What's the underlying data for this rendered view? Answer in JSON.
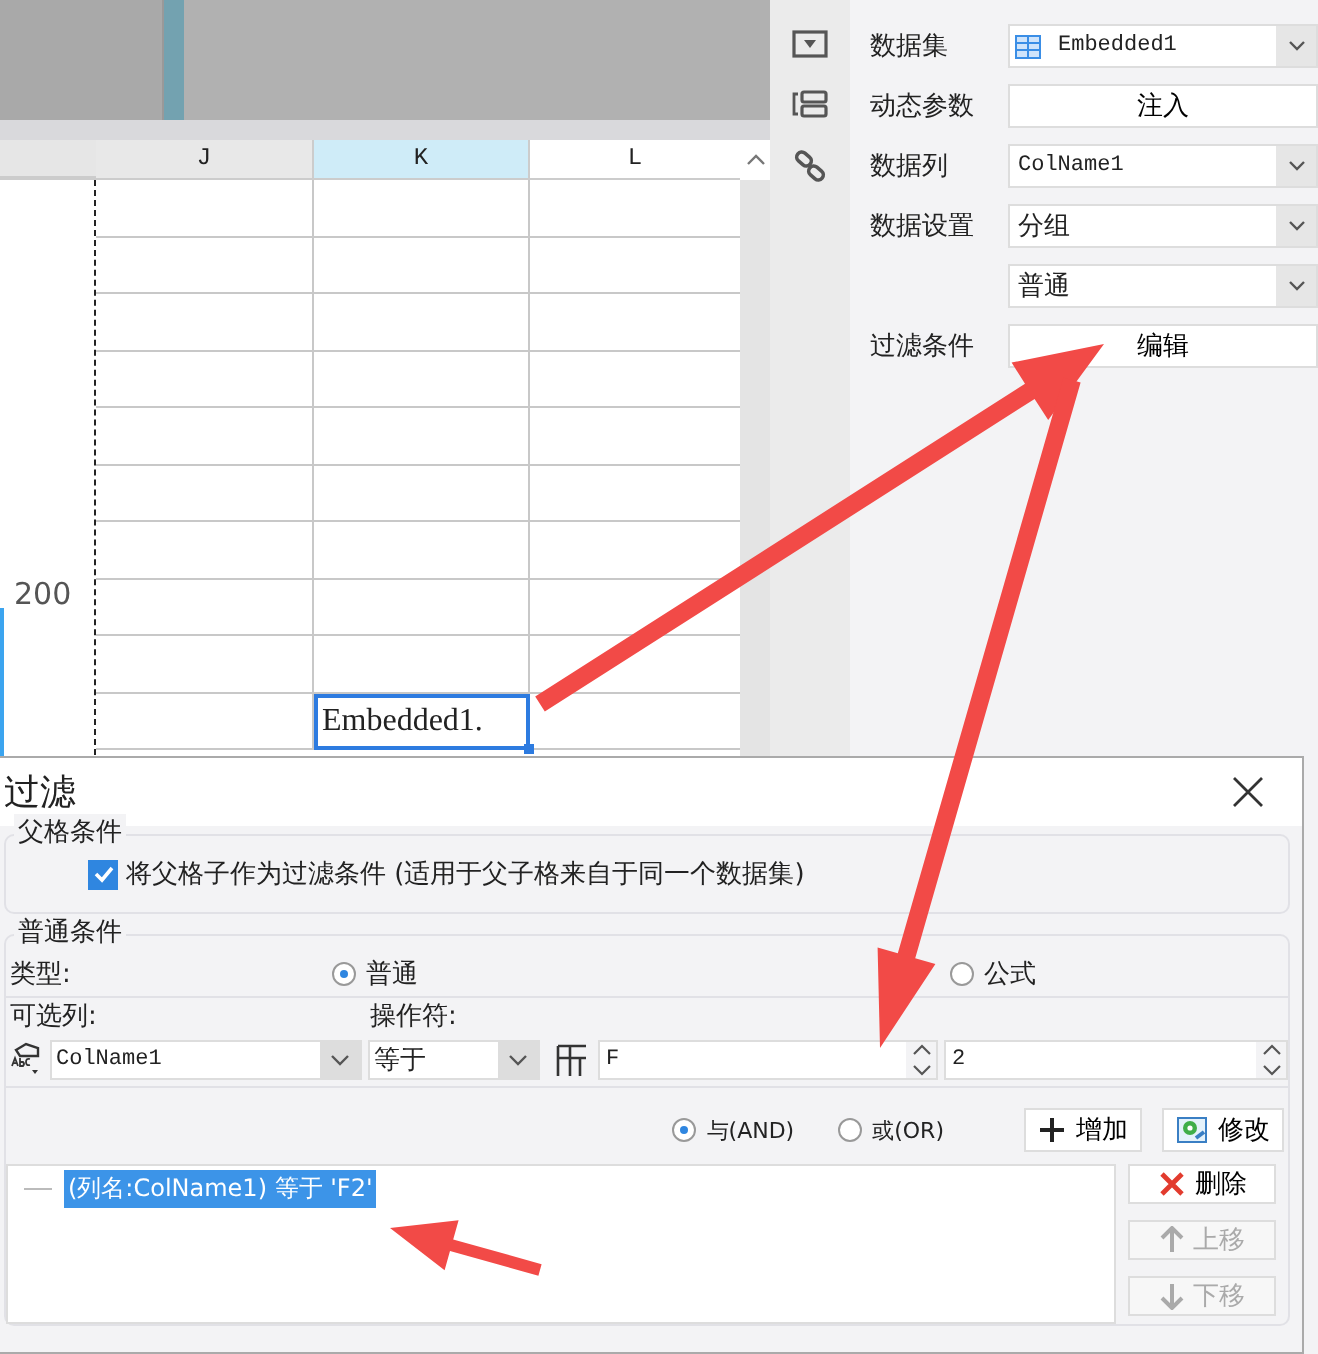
{
  "spreadsheet": {
    "columns": [
      {
        "label": "J",
        "selected": false
      },
      {
        "label": "K",
        "selected": true
      },
      {
        "label": "L",
        "selected": false
      }
    ],
    "row_label": "200",
    "active_cell": {
      "text": "Embedded1."
    }
  },
  "properties": [
    {
      "label": "数据集",
      "kind": "dataset",
      "value": "Embedded1"
    },
    {
      "label": "动态参数",
      "kind": "button",
      "value": "注入"
    },
    {
      "label": "数据列",
      "kind": "column",
      "value": "ColName1"
    },
    {
      "label": "数据设置",
      "kind": "select",
      "value": "分组"
    },
    {
      "kind": "select",
      "value": "普通"
    },
    {
      "label": "过滤条件",
      "kind": "button",
      "value": "编辑"
    }
  ],
  "dialog": {
    "title": "过滤",
    "parent_condition": {
      "legend": "父格条件",
      "checkbox": {
        "label": "将父格子作为过滤条件 (适用于父子格来自于同一个数据集)",
        "checked": true
      }
    },
    "normal_condition": {
      "legend": "普通条件",
      "type_label": "类型:",
      "type_options": [
        {
          "label": "普通",
          "selected": true
        },
        {
          "label": "公式",
          "selected": false
        }
      ],
      "column_label": "可选列:",
      "operator_label": "操作符:",
      "column_value": "ColName1",
      "operator_value": "等于",
      "value_1": "F",
      "value_2": "2",
      "logic_options": [
        {
          "label": "与(AND)",
          "selected": true
        },
        {
          "label": "或(OR)",
          "selected": false
        }
      ],
      "buttons": [
        {
          "label": "增加",
          "kind": "add"
        },
        {
          "label": "修改",
          "kind": "edit"
        }
      ],
      "conditions": [
        {
          "text": "(列名:ColName1) 等于 'F2'",
          "selected": true
        }
      ],
      "side_buttons": [
        {
          "label": "删除",
          "kind": "delete",
          "disabled": false
        },
        {
          "label": "上移",
          "kind": "up",
          "disabled": true
        },
        {
          "label": "下移",
          "kind": "down",
          "disabled": true
        }
      ]
    }
  }
}
